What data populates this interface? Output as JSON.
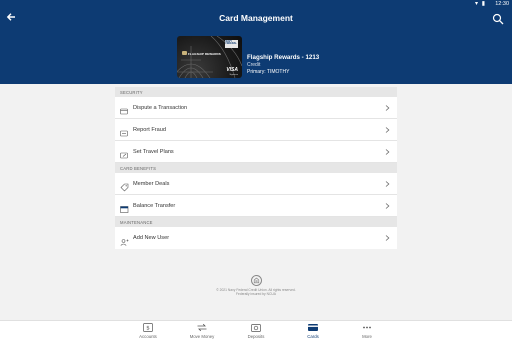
{
  "status_bar": {
    "time": "12:30"
  },
  "header": {
    "title": "Card Management"
  },
  "card": {
    "name": "Flagship Rewards - 1213",
    "type": "Credit",
    "primary": "Primary: TIMOTHY",
    "art_brand": "NAVY FEDERAL",
    "art_name": "FLAGSHIP REWARDS",
    "art_network": "VISA",
    "art_network_sub": "Signature"
  },
  "sections": [
    {
      "title": "SECURITY",
      "items": [
        {
          "label": "Dispute a Transaction",
          "icon": "card-dispute-icon"
        },
        {
          "label": "Report Fraud",
          "icon": "card-fraud-icon"
        },
        {
          "label": "Set Travel Plans",
          "icon": "card-travel-icon"
        }
      ]
    },
    {
      "title": "CARD BENEFITS",
      "items": [
        {
          "label": "Member Deals",
          "icon": "member-deals-icon"
        },
        {
          "label": "Balance Transfer",
          "icon": "balance-transfer-icon"
        }
      ]
    },
    {
      "title": "MAINTENANCE",
      "items": [
        {
          "label": "Add New User",
          "icon": "add-user-icon"
        }
      ]
    }
  ],
  "footer": {
    "copyright": "© 2021 Navy Federal Credit Union. All rights reserved.",
    "insured": "Federally insured by NCUA"
  },
  "bottom_nav": [
    {
      "label": "Accounts",
      "icon": "accounts-icon",
      "active": false
    },
    {
      "label": "Move Money",
      "icon": "move-money-icon",
      "active": false
    },
    {
      "label": "Deposits",
      "icon": "camera-icon",
      "active": false
    },
    {
      "label": "Cards",
      "icon": "cards-icon",
      "active": true
    },
    {
      "label": "More",
      "icon": "more-icon",
      "active": false
    }
  ],
  "colors": {
    "primary": "#0d3b73",
    "background": "#f2f2f2",
    "section_header": "#e6e6e6"
  }
}
